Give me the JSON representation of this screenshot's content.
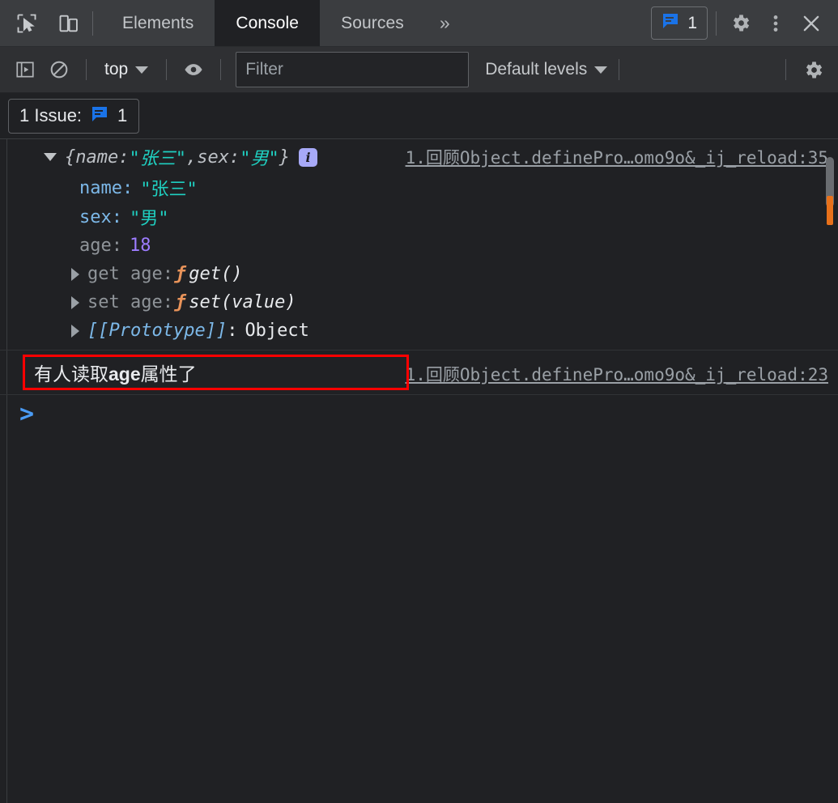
{
  "window": {
    "app": "Chrome DevTools"
  },
  "tabbar": {
    "inspect_icon": "inspect-cursor-icon",
    "device_icon": "device-toolbar-icon",
    "tabs": [
      {
        "label": "Elements",
        "active": false
      },
      {
        "label": "Console",
        "active": true
      },
      {
        "label": "Sources",
        "active": false
      }
    ],
    "more_tabs_glyph": "»",
    "issue_chip": {
      "icon": "message-bubble-icon",
      "count": "1"
    },
    "settings_icon": "gear-icon",
    "more_options_icon": "kebab-menu-icon",
    "close_icon": "close-icon"
  },
  "console_toolbar": {
    "sidebar_toggle_icon": "console-sidebar-icon",
    "clear_icon": "clear-console-icon",
    "context": "top",
    "eye_icon": "live-expression-eye-icon",
    "filter": {
      "placeholder": "Filter",
      "value": ""
    },
    "levels": "Default levels",
    "settings_icon": "gear-icon"
  },
  "issues_bar": {
    "label": "1 Issue:",
    "icon": "message-bubble-icon",
    "count": "1"
  },
  "console": {
    "messages": [
      {
        "type": "object",
        "source_link": "1.回顾Object.definePro…omo9o&_ij_reload:35",
        "preview": {
          "open_brace": "{",
          "parts": [
            {
              "key": "name",
              "sep": ": ",
              "value": "\"张三\"",
              "tail": ", "
            },
            {
              "key": "sex",
              "sep": ": ",
              "value": "\"男\"",
              "tail": ""
            }
          ],
          "close_brace": "}",
          "info_badge": "i"
        },
        "properties": [
          {
            "expandable": false,
            "key": "name",
            "key_style": "key",
            "sep": ":",
            "value": "\"张三\"",
            "value_style": "str"
          },
          {
            "expandable": false,
            "key": "sex",
            "key_style": "key",
            "sep": ":",
            "value": "\"男\"",
            "value_style": "str"
          },
          {
            "expandable": false,
            "key": "age",
            "key_style": "key-dim",
            "sep": ":",
            "value": "18",
            "value_style": "num"
          },
          {
            "expandable": true,
            "key": "get age",
            "key_style": "key-dim",
            "sep": ":",
            "fn": "ƒ",
            "value": "get()",
            "value_style": "fn-sig"
          },
          {
            "expandable": true,
            "key": "set age",
            "key_style": "key-dim",
            "sep": ":",
            "fn": "ƒ",
            "value": "set(value)",
            "value_style": "fn-sig"
          },
          {
            "expandable": true,
            "key": "[[Prototype]]",
            "key_style": "proto",
            "sep": ":",
            "value": "Object",
            "value_style": "plain"
          }
        ]
      },
      {
        "type": "text",
        "text_before": "有人读取",
        "text_bold": "age",
        "text_after": "属性了",
        "source_link": "1.回顾Object.definePro…omo9o&_ij_reload:23",
        "annotated": true,
        "annotation_color": "#ff0000"
      }
    ],
    "prompt_glyph": ">"
  },
  "scrollbar": {
    "thumb": "scroll-thumb",
    "marker_color": "#e8711a"
  }
}
